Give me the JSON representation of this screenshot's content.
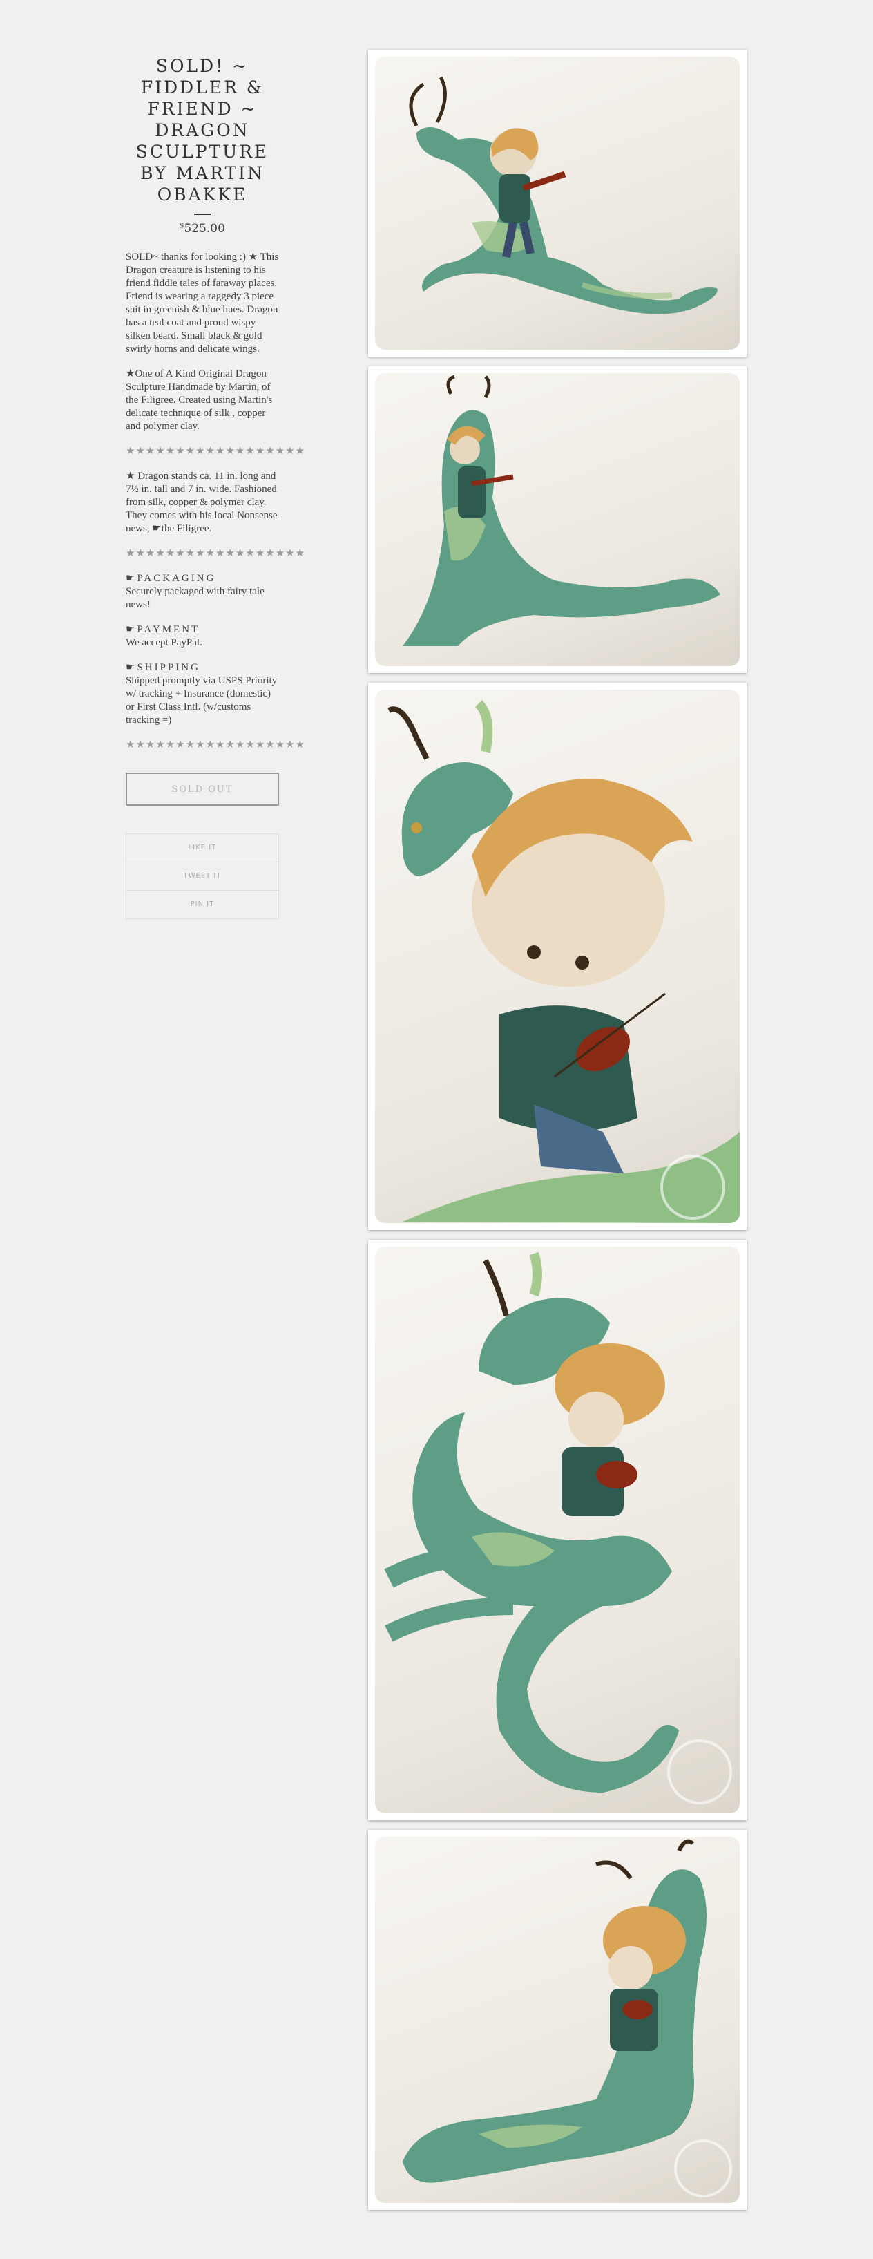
{
  "product": {
    "title": "SOLD! ~ FIDDLER & FRIEND ~ DRAGON SCULPTURE BY MARTIN OBAKKE",
    "price_symbol": "$",
    "price": "525.00",
    "description": {
      "p1": "SOLD~ thanks for looking :) ★ This Dragon creature is listening to his friend fiddle tales of faraway places. Friend is wearing a raggedy 3 piece suit in greenish & blue hues. Dragon has a teal coat and proud wispy silken beard. Small black & gold swirly horns and delicate wings.",
      "p2": "★One of A Kind Original Dragon Sculpture Handmade by Martin, of the Filigree. Created using Martin's delicate technique of silk , copper and polymer clay.",
      "stars1": "★★★★★★★★★★★★★★★★★★",
      "p3": "★ Dragon stands ca. 11 in. long and 7½ in. tall and 7 in. wide. Fashioned from silk, copper & polymer clay. They comes with his local Nonsense news, ☛the Filigree.",
      "stars2": "★★★★★★★★★★★★★★★★★★",
      "packaging_heading": "☛PACKAGING",
      "packaging_text": "Securely packaged with fairy tale news!",
      "payment_heading": "☛PAYMENT",
      "payment_text": "We accept PayPal.",
      "shipping_heading": "☛SHIPPING",
      "shipping_text": "Shipped promptly via USPS Priority w/ tracking + Insurance (domestic) or First Class Intl. (w/customs tracking =)",
      "stars3": "★★★★★★★★★★★★★★★★★★"
    },
    "sold_out_label": "SOLD OUT",
    "share": {
      "like": "LIKE IT",
      "tweet": "TWEET IT",
      "pin": "PIN IT"
    }
  },
  "photos": [
    {
      "alt": "dragon sculpture with fiddler, side view"
    },
    {
      "alt": "dragon sculpture with fiddler, front view"
    },
    {
      "alt": "fiddler close-up"
    },
    {
      "alt": "dragon sculpture, top view"
    },
    {
      "alt": "dragon sculpture, rear view"
    }
  ],
  "colors": {
    "background": "#f0f0f0",
    "dragon": "#5e9e86",
    "dragon_light": "#a6c98e",
    "hair": "#d9a456",
    "violin": "#8b2a14"
  }
}
